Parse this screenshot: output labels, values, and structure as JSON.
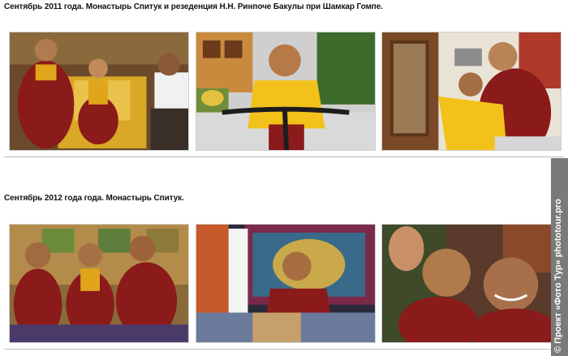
{
  "sections": [
    {
      "caption": "Сентябрь 2011 года. Монастырь Спитук и резеденция Н.Н. Ринпоче Бакулы при Шамкар Гомпе."
    },
    {
      "caption": "Сентябрь 2012 года года. Монастырь Спитук."
    }
  ],
  "watermark": {
    "text": "© Проект «Фото Тур» phototour.pro"
  },
  "colors": {
    "monk_robe": "#8b1a1a",
    "yellow_shirt": "#f2c21b",
    "separator": "#bdbdbd"
  }
}
